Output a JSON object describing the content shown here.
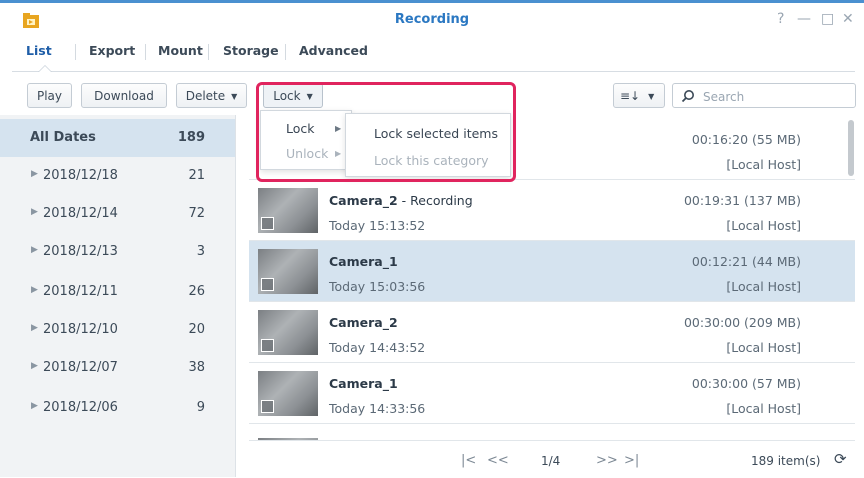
{
  "window": {
    "title": "Recording",
    "controls": {
      "help": "?",
      "minimize": "—",
      "maximize": "□",
      "close": "✕"
    }
  },
  "tabs": [
    "List",
    "Export",
    "Mount",
    "Storage",
    "Advanced"
  ],
  "toolbar": {
    "play": "Play",
    "download": "Download",
    "delete": "Delete",
    "lock": "Lock",
    "sort_icon": "≡↓",
    "search_placeholder": "Search"
  },
  "lock_menu": {
    "items": [
      {
        "label": "Lock",
        "enabled": true
      },
      {
        "label": "Unlock",
        "enabled": false
      }
    ],
    "submenu": [
      {
        "label": "Lock selected items",
        "enabled": true
      },
      {
        "label": "Lock this category",
        "enabled": false
      }
    ]
  },
  "dates": [
    {
      "label": "All Dates",
      "count": "189"
    },
    {
      "label": "2018/12/18",
      "count": "21"
    },
    {
      "label": "2018/12/14",
      "count": "72"
    },
    {
      "label": "2018/12/13",
      "count": "3"
    },
    {
      "label": "2018/12/11",
      "count": "26"
    },
    {
      "label": "2018/12/10",
      "count": "20"
    },
    {
      "label": "2018/12/07",
      "count": "38"
    },
    {
      "label": "2018/12/06",
      "count": "9"
    }
  ],
  "recordings": [
    {
      "camera": "",
      "suffix": "",
      "time": "",
      "duration": "00:16:20 (55 MB)",
      "host": "[Local Host]"
    },
    {
      "camera": "Camera_2",
      "suffix": " - Recording",
      "time": "Today 15:13:52",
      "duration": "00:19:31 (137 MB)",
      "host": "[Local Host]"
    },
    {
      "camera": "Camera_1",
      "suffix": "",
      "time": "Today 15:03:56",
      "duration": "00:12:21 (44 MB)",
      "host": "[Local Host]"
    },
    {
      "camera": "Camera_2",
      "suffix": "",
      "time": "Today 14:43:52",
      "duration": "00:30:00 (209 MB)",
      "host": "[Local Host]"
    },
    {
      "camera": "Camera_1",
      "suffix": "",
      "time": "Today 14:33:56",
      "duration": "00:30:00 (57 MB)",
      "host": "[Local Host]"
    }
  ],
  "pager": {
    "first": "|<",
    "prev": "<<",
    "page": "1/4",
    "next": ">>",
    "last": ">|",
    "total": "189 item(s)",
    "refresh": "⟳"
  },
  "colors": {
    "accent": "#2b78c2",
    "selection": "#d5e3ef",
    "highlight_box": "#e0245e"
  }
}
